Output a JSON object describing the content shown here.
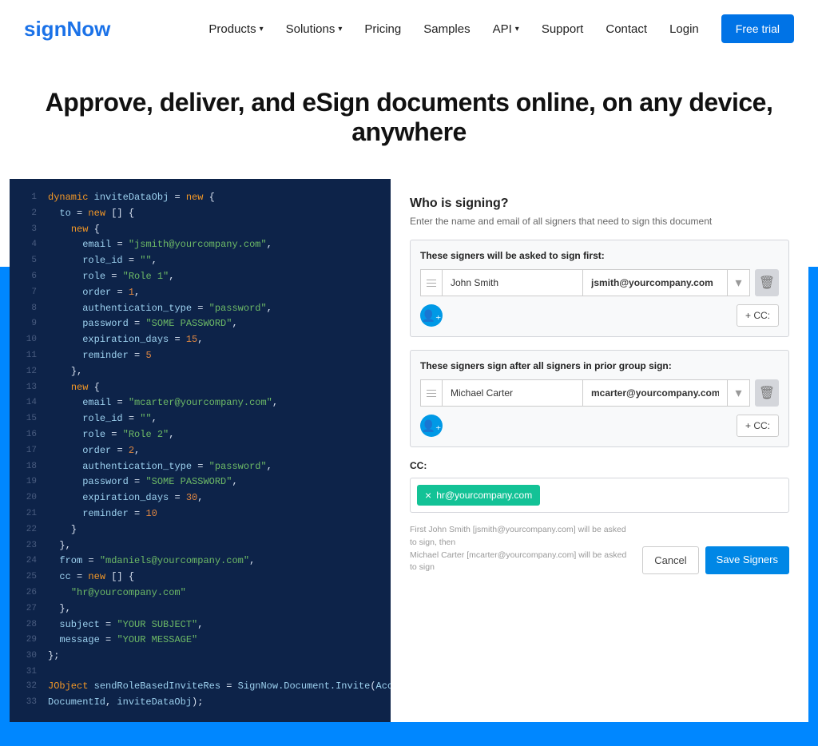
{
  "header": {
    "logo": "signNow",
    "nav": {
      "products": "Products",
      "solutions": "Solutions",
      "pricing": "Pricing",
      "samples": "Samples",
      "api": "API",
      "support": "Support",
      "contact": "Contact",
      "login": "Login",
      "trial": "Free trial"
    }
  },
  "hero": {
    "title": "Approve, deliver, and eSign documents online, on any device, anywhere"
  },
  "code": {
    "lines": [
      {
        "n": "1",
        "html": "<span class='kw'>dynamic</span> <span class='prop'>inviteDataObj</span> <span class='punct'>=</span> <span class='kw'>new</span> <span class='punct'>{</span>"
      },
      {
        "n": "2",
        "html": "  <span class='prop'>to</span> <span class='punct'>=</span> <span class='kw'>new</span> <span class='punct'>[] {</span>"
      },
      {
        "n": "3",
        "html": "    <span class='kw'>new</span> <span class='punct'>{</span>"
      },
      {
        "n": "4",
        "html": "      <span class='prop'>email</span> <span class='punct'>=</span> <span class='str'>\"jsmith@yourcompany.com\"</span><span class='punct'>,</span>"
      },
      {
        "n": "5",
        "html": "      <span class='prop'>role_id</span> <span class='punct'>=</span> <span class='str'>\"\"</span><span class='punct'>,</span>"
      },
      {
        "n": "6",
        "html": "      <span class='prop'>role</span> <span class='punct'>=</span> <span class='str'>\"Role 1\"</span><span class='punct'>,</span>"
      },
      {
        "n": "7",
        "html": "      <span class='prop'>order</span> <span class='punct'>=</span> <span class='num'>1</span><span class='punct'>,</span>"
      },
      {
        "n": "8",
        "html": "      <span class='prop'>authentication_type</span> <span class='punct'>=</span> <span class='str'>\"password\"</span><span class='punct'>,</span>"
      },
      {
        "n": "9",
        "html": "      <span class='prop'>password</span> <span class='punct'>=</span> <span class='str'>\"SOME PASSWORD\"</span><span class='punct'>,</span>"
      },
      {
        "n": "10",
        "html": "      <span class='prop'>expiration_days</span> <span class='punct'>=</span> <span class='num'>15</span><span class='punct'>,</span>"
      },
      {
        "n": "11",
        "html": "      <span class='prop'>reminder</span> <span class='punct'>=</span> <span class='num'>5</span>"
      },
      {
        "n": "12",
        "html": "    <span class='punct'>},</span>"
      },
      {
        "n": "13",
        "html": "    <span class='kw'>new</span> <span class='punct'>{</span>"
      },
      {
        "n": "14",
        "html": "      <span class='prop'>email</span> <span class='punct'>=</span> <span class='str'>\"mcarter@yourcompany.com\"</span><span class='punct'>,</span>"
      },
      {
        "n": "15",
        "html": "      <span class='prop'>role_id</span> <span class='punct'>=</span> <span class='str'>\"\"</span><span class='punct'>,</span>"
      },
      {
        "n": "16",
        "html": "      <span class='prop'>role</span> <span class='punct'>=</span> <span class='str'>\"Role 2\"</span><span class='punct'>,</span>"
      },
      {
        "n": "17",
        "html": "      <span class='prop'>order</span> <span class='punct'>=</span> <span class='num'>2</span><span class='punct'>,</span>"
      },
      {
        "n": "18",
        "html": "      <span class='prop'>authentication_type</span> <span class='punct'>=</span> <span class='str'>\"password\"</span><span class='punct'>,</span>"
      },
      {
        "n": "19",
        "html": "      <span class='prop'>password</span> <span class='punct'>=</span> <span class='str'>\"SOME PASSWORD\"</span><span class='punct'>,</span>"
      },
      {
        "n": "20",
        "html": "      <span class='prop'>expiration_days</span> <span class='punct'>=</span> <span class='num'>30</span><span class='punct'>,</span>"
      },
      {
        "n": "21",
        "html": "      <span class='prop'>reminder</span> <span class='punct'>=</span> <span class='num'>10</span>"
      },
      {
        "n": "22",
        "html": "    <span class='punct'>}</span>"
      },
      {
        "n": "23",
        "html": "  <span class='punct'>},</span>"
      },
      {
        "n": "24",
        "html": "  <span class='prop'>from</span> <span class='punct'>=</span> <span class='str'>\"mdaniels@yourcompany.com\"</span><span class='punct'>,</span>"
      },
      {
        "n": "25",
        "html": "  <span class='prop'>cc</span> <span class='punct'>=</span> <span class='kw'>new</span> <span class='punct'>[] {</span>"
      },
      {
        "n": "26",
        "html": "    <span class='str'>\"hr@yourcompany.com\"</span>"
      },
      {
        "n": "27",
        "html": "  <span class='punct'>},</span>"
      },
      {
        "n": "28",
        "html": "  <span class='prop'>subject</span> <span class='punct'>=</span> <span class='str'>\"YOUR SUBJECT\"</span><span class='punct'>,</span>"
      },
      {
        "n": "29",
        "html": "  <span class='prop'>message</span> <span class='punct'>=</span> <span class='str'>\"YOUR MESSAGE\"</span>"
      },
      {
        "n": "30",
        "html": "<span class='punct'>};</span>"
      },
      {
        "n": "31",
        "html": ""
      },
      {
        "n": "32",
        "html": "<span class='kw'>JObject</span> <span class='prop'>sendRoleBasedInviteRes</span> <span class='punct'>=</span> <span class='prop'>SignNow.Document.Invite</span><span class='punct'>(</span><span class='prop'>AccessToken</span><span class='punct'>,</span>"
      },
      {
        "n": "33",
        "html": "<span class='prop'>DocumentId</span><span class='punct'>,</span> <span class='prop'>inviteDataObj</span><span class='punct'>);</span>"
      }
    ]
  },
  "form": {
    "title": "Who is signing?",
    "subtitle": "Enter the name and email of all signers that need to sign this document",
    "group1": {
      "label": "These signers will be asked to sign first:",
      "name": "John Smith",
      "email": "jsmith@yourcompany.com",
      "cc_btn": "+ CC:"
    },
    "group2": {
      "label": "These signers sign after all signers in prior group sign:",
      "name": "Michael Carter",
      "email": "mcarter@yourcompany.com",
      "cc_btn": "+ CC:"
    },
    "cc": {
      "label": "CC:",
      "tag": "hr@yourcompany.com"
    },
    "footer": {
      "note1": "First John Smith [jsmith@yourcompany.com] will be asked to sign, then",
      "note2": "Michael Carter [mcarter@yourcompany.com] will be asked to sign",
      "cancel": "Cancel",
      "save": "Save Signers"
    }
  }
}
